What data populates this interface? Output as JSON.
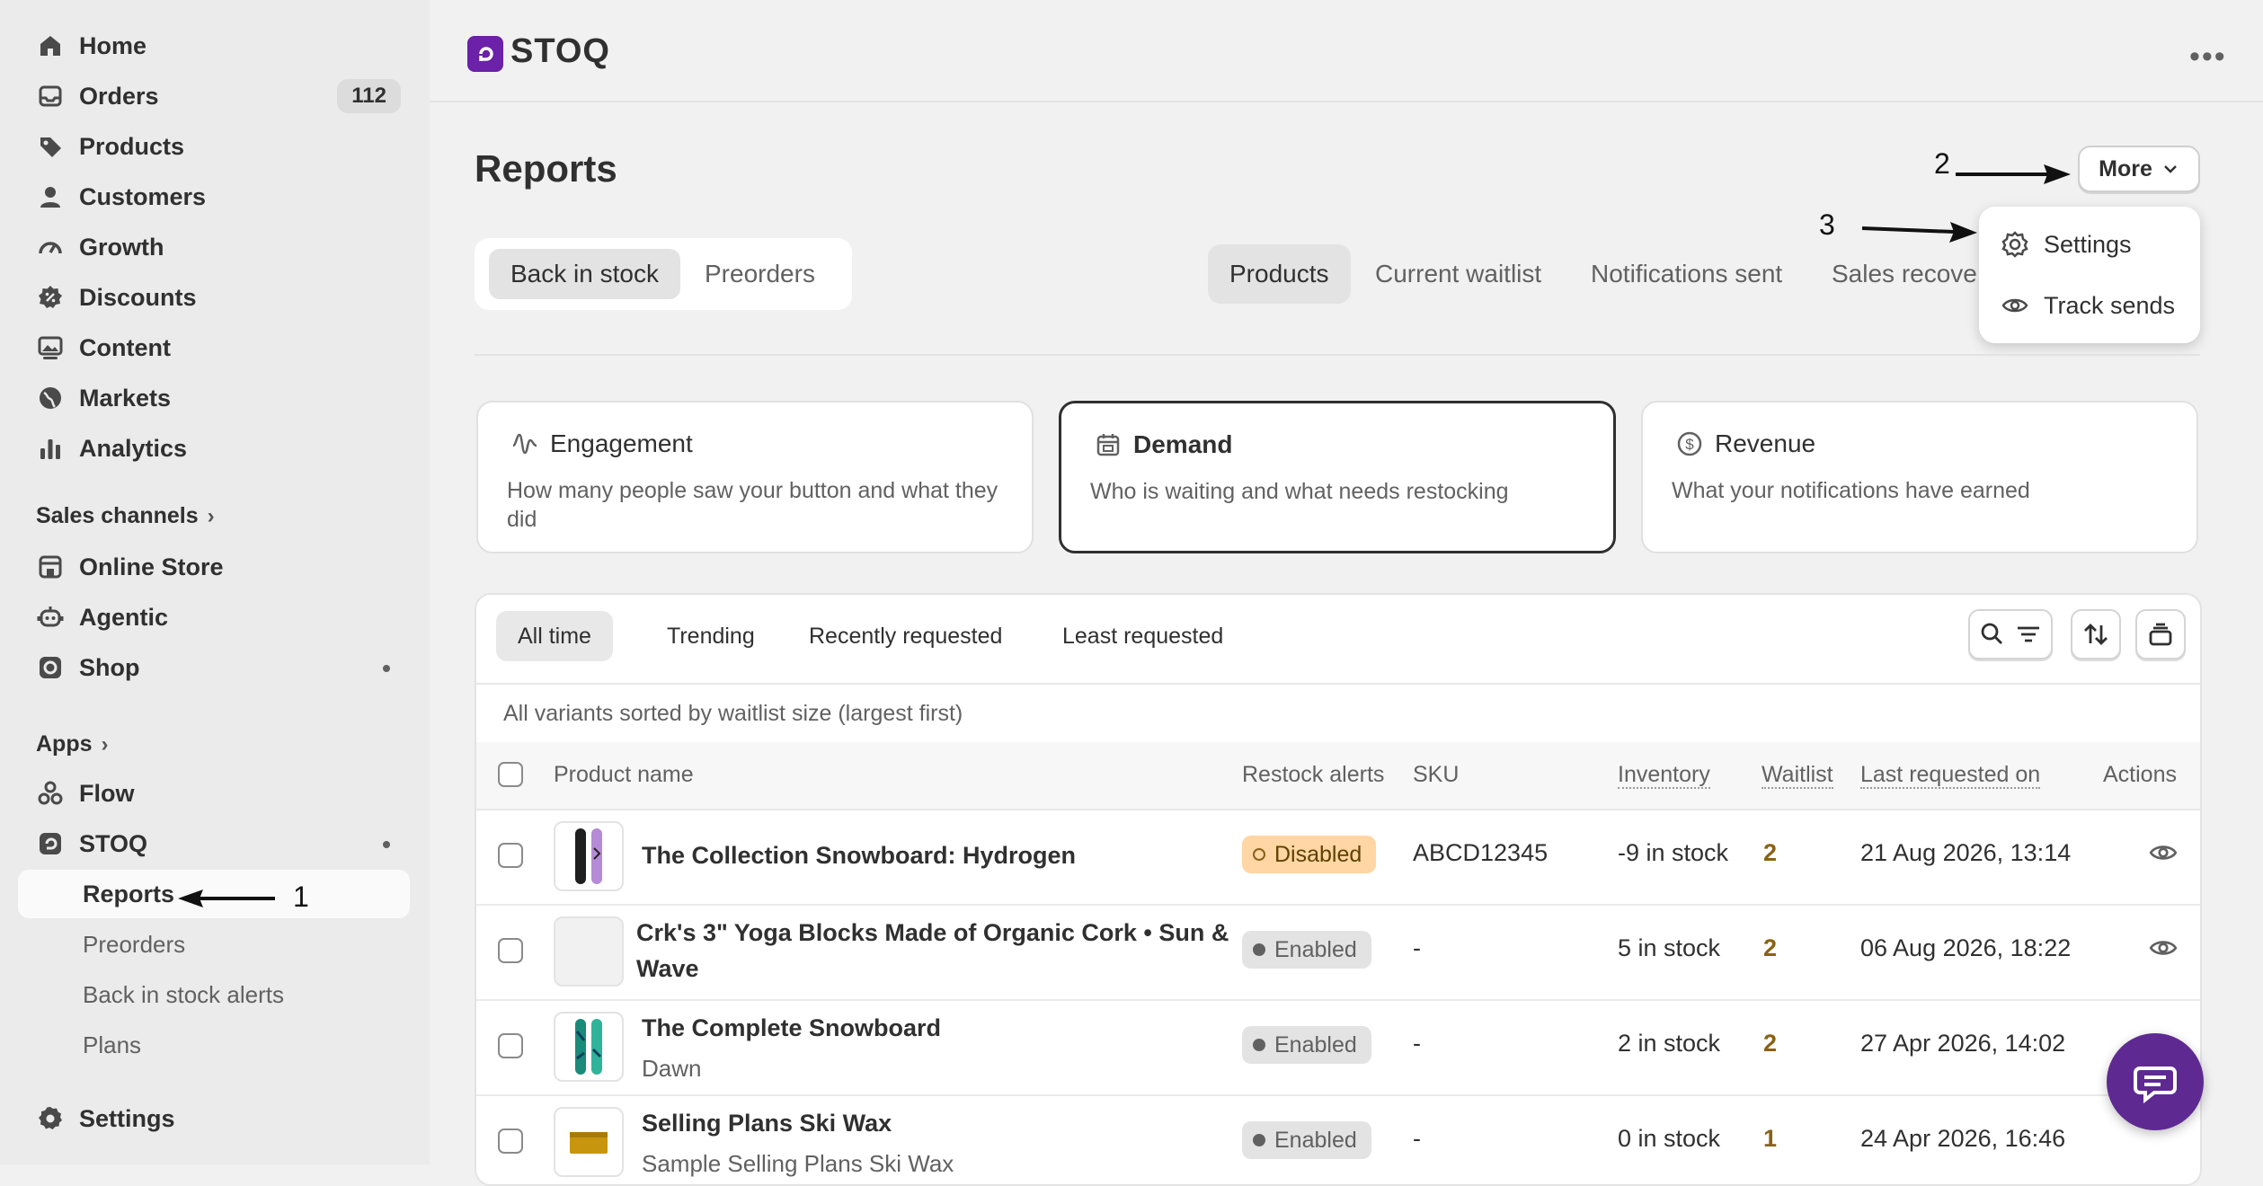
{
  "sidebar": {
    "items": [
      {
        "label": "Home",
        "icon": "home-icon"
      },
      {
        "label": "Orders",
        "icon": "inbox-icon",
        "badge": "112"
      },
      {
        "label": "Products",
        "icon": "tag-icon"
      },
      {
        "label": "Customers",
        "icon": "person-icon"
      },
      {
        "label": "Growth",
        "icon": "gauge-icon"
      },
      {
        "label": "Discounts",
        "icon": "discount-icon"
      },
      {
        "label": "Content",
        "icon": "image-icon"
      },
      {
        "label": "Markets",
        "icon": "globe-icon"
      },
      {
        "label": "Analytics",
        "icon": "bar-chart-icon"
      }
    ],
    "sales_channels_label": "Sales channels",
    "channels": [
      {
        "label": "Online Store",
        "icon": "store-icon"
      },
      {
        "label": "Agentic",
        "icon": "agent-icon"
      },
      {
        "label": "Shop",
        "icon": "shop-icon"
      }
    ],
    "apps_label": "Apps",
    "apps": [
      {
        "label": "Flow",
        "icon": "flow-icon"
      },
      {
        "label": "STOQ",
        "icon": "stoq-icon"
      }
    ],
    "stoq_sub": [
      "Reports",
      "Preorders",
      "Back in stock alerts",
      "Plans"
    ],
    "settings_label": "Settings"
  },
  "app": {
    "name": "STOQ",
    "brand_color": "#6b21a8"
  },
  "page": {
    "title": "Reports",
    "more_label": "More"
  },
  "dropdown": {
    "items": [
      "Settings",
      "Track sends"
    ]
  },
  "annotations": [
    "1",
    "2",
    "3"
  ],
  "segment": [
    "Back in stock",
    "Preorders"
  ],
  "report_tabs": [
    "Products",
    "Current waitlist",
    "Notifications sent",
    "Sales recove"
  ],
  "cards": [
    {
      "title": "Engagement",
      "desc": "How many people saw your button and what they did"
    },
    {
      "title": "Demand",
      "desc": "Who is waiting and what needs restocking"
    },
    {
      "title": "Revenue",
      "desc": "What your notifications have earned"
    }
  ],
  "filters": [
    "All time",
    "Trending",
    "Recently requested",
    "Least requested"
  ],
  "table": {
    "subtitle": "All variants sorted by waitlist size (largest first)",
    "headers": {
      "product": "Product name",
      "restock": "Restock alerts",
      "sku": "SKU",
      "inventory": "Inventory",
      "waitlist": "Waitlist",
      "last": "Last requested on",
      "actions": "Actions"
    },
    "rows": [
      {
        "name": "The Collection Snowboard: Hydrogen",
        "variant": "",
        "status": "Disabled",
        "sku": "ABCD12345",
        "inventory": "-9 in stock",
        "waitlist": "2",
        "last": "21 Aug 2026, 13:14"
      },
      {
        "name": "Crk's 3\" Yoga Blocks Made of Organic Cork • Sun &",
        "name2": "Wave",
        "variant": "",
        "status": "Enabled",
        "sku": "-",
        "inventory": "5 in stock",
        "waitlist": "2",
        "last": "06 Aug 2026, 18:22"
      },
      {
        "name": "The Complete Snowboard",
        "variant": "Dawn",
        "status": "Enabled",
        "sku": "-",
        "inventory": "2 in stock",
        "waitlist": "2",
        "last": "27 Apr 2026, 14:02"
      },
      {
        "name": "Selling Plans Ski Wax",
        "variant": "Sample Selling Plans Ski Wax",
        "status": "Enabled",
        "sku": "-",
        "inventory": "0 in stock",
        "waitlist": "1",
        "last": "24 Apr 2026, 16:46"
      }
    ]
  }
}
